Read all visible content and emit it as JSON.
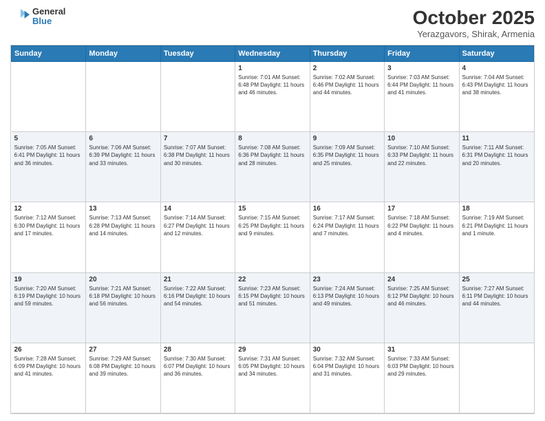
{
  "header": {
    "logo_line1": "General",
    "logo_line2": "Blue",
    "title": "October 2025",
    "subtitle": "Yerazgavors, Shirak, Armenia"
  },
  "days_of_week": [
    "Sunday",
    "Monday",
    "Tuesday",
    "Wednesday",
    "Thursday",
    "Friday",
    "Saturday"
  ],
  "weeks": [
    [
      {
        "day": "",
        "info": ""
      },
      {
        "day": "",
        "info": ""
      },
      {
        "day": "",
        "info": ""
      },
      {
        "day": "1",
        "info": "Sunrise: 7:01 AM\nSunset: 6:48 PM\nDaylight: 11 hours and 46 minutes."
      },
      {
        "day": "2",
        "info": "Sunrise: 7:02 AM\nSunset: 6:46 PM\nDaylight: 11 hours and 44 minutes."
      },
      {
        "day": "3",
        "info": "Sunrise: 7:03 AM\nSunset: 6:44 PM\nDaylight: 11 hours and 41 minutes."
      },
      {
        "day": "4",
        "info": "Sunrise: 7:04 AM\nSunset: 6:43 PM\nDaylight: 11 hours and 38 minutes."
      }
    ],
    [
      {
        "day": "5",
        "info": "Sunrise: 7:05 AM\nSunset: 6:41 PM\nDaylight: 11 hours and 36 minutes."
      },
      {
        "day": "6",
        "info": "Sunrise: 7:06 AM\nSunset: 6:39 PM\nDaylight: 11 hours and 33 minutes."
      },
      {
        "day": "7",
        "info": "Sunrise: 7:07 AM\nSunset: 6:38 PM\nDaylight: 11 hours and 30 minutes."
      },
      {
        "day": "8",
        "info": "Sunrise: 7:08 AM\nSunset: 6:36 PM\nDaylight: 11 hours and 28 minutes."
      },
      {
        "day": "9",
        "info": "Sunrise: 7:09 AM\nSunset: 6:35 PM\nDaylight: 11 hours and 25 minutes."
      },
      {
        "day": "10",
        "info": "Sunrise: 7:10 AM\nSunset: 6:33 PM\nDaylight: 11 hours and 22 minutes."
      },
      {
        "day": "11",
        "info": "Sunrise: 7:11 AM\nSunset: 6:31 PM\nDaylight: 11 hours and 20 minutes."
      }
    ],
    [
      {
        "day": "12",
        "info": "Sunrise: 7:12 AM\nSunset: 6:30 PM\nDaylight: 11 hours and 17 minutes."
      },
      {
        "day": "13",
        "info": "Sunrise: 7:13 AM\nSunset: 6:28 PM\nDaylight: 11 hours and 14 minutes."
      },
      {
        "day": "14",
        "info": "Sunrise: 7:14 AM\nSunset: 6:27 PM\nDaylight: 11 hours and 12 minutes."
      },
      {
        "day": "15",
        "info": "Sunrise: 7:15 AM\nSunset: 6:25 PM\nDaylight: 11 hours and 9 minutes."
      },
      {
        "day": "16",
        "info": "Sunrise: 7:17 AM\nSunset: 6:24 PM\nDaylight: 11 hours and 7 minutes."
      },
      {
        "day": "17",
        "info": "Sunrise: 7:18 AM\nSunset: 6:22 PM\nDaylight: 11 hours and 4 minutes."
      },
      {
        "day": "18",
        "info": "Sunrise: 7:19 AM\nSunset: 6:21 PM\nDaylight: 11 hours and 1 minute."
      }
    ],
    [
      {
        "day": "19",
        "info": "Sunrise: 7:20 AM\nSunset: 6:19 PM\nDaylight: 10 hours and 59 minutes."
      },
      {
        "day": "20",
        "info": "Sunrise: 7:21 AM\nSunset: 6:18 PM\nDaylight: 10 hours and 56 minutes."
      },
      {
        "day": "21",
        "info": "Sunrise: 7:22 AM\nSunset: 6:16 PM\nDaylight: 10 hours and 54 minutes."
      },
      {
        "day": "22",
        "info": "Sunrise: 7:23 AM\nSunset: 6:15 PM\nDaylight: 10 hours and 51 minutes."
      },
      {
        "day": "23",
        "info": "Sunrise: 7:24 AM\nSunset: 6:13 PM\nDaylight: 10 hours and 49 minutes."
      },
      {
        "day": "24",
        "info": "Sunrise: 7:25 AM\nSunset: 6:12 PM\nDaylight: 10 hours and 46 minutes."
      },
      {
        "day": "25",
        "info": "Sunrise: 7:27 AM\nSunset: 6:11 PM\nDaylight: 10 hours and 44 minutes."
      }
    ],
    [
      {
        "day": "26",
        "info": "Sunrise: 7:28 AM\nSunset: 6:09 PM\nDaylight: 10 hours and 41 minutes."
      },
      {
        "day": "27",
        "info": "Sunrise: 7:29 AM\nSunset: 6:08 PM\nDaylight: 10 hours and 39 minutes."
      },
      {
        "day": "28",
        "info": "Sunrise: 7:30 AM\nSunset: 6:07 PM\nDaylight: 10 hours and 36 minutes."
      },
      {
        "day": "29",
        "info": "Sunrise: 7:31 AM\nSunset: 6:05 PM\nDaylight: 10 hours and 34 minutes."
      },
      {
        "day": "30",
        "info": "Sunrise: 7:32 AM\nSunset: 6:04 PM\nDaylight: 10 hours and 31 minutes."
      },
      {
        "day": "31",
        "info": "Sunrise: 7:33 AM\nSunset: 6:03 PM\nDaylight: 10 hours and 29 minutes."
      },
      {
        "day": "",
        "info": ""
      }
    ]
  ]
}
